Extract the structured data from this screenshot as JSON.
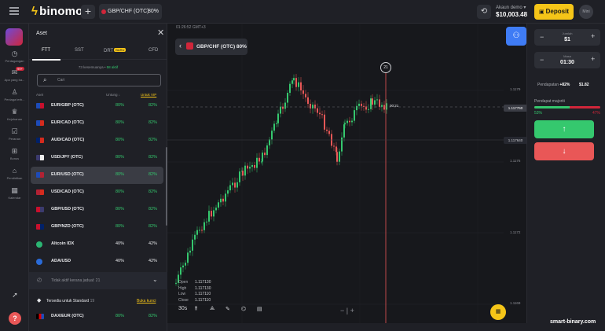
{
  "header": {
    "brand": "binomo",
    "asset_tab": {
      "label": "GBP/CHF (OTC)",
      "percent": "80%"
    },
    "account": {
      "label": "Akaun demo ▾",
      "balance": "$10,003.48"
    },
    "deposit_label": "Deposit",
    "avatar_text": "Mini"
  },
  "nav": [
    {
      "icon": "chart-icon",
      "label": "Perdagangan"
    },
    {
      "icon": "gift-icon",
      "label": "Apa yang ba...",
      "badge": "99+"
    },
    {
      "icon": "trader-icon",
      "label": "Peniaga terb..."
    },
    {
      "icon": "trophy-icon",
      "label": "Kejohanan"
    },
    {
      "icon": "tasks-icon",
      "label": "Peranan"
    },
    {
      "icon": "bonus-icon",
      "label": "Bonus"
    },
    {
      "icon": "education-icon",
      "label": "Pendidikan"
    },
    {
      "icon": "calendar-icon",
      "label": "Kalendar"
    }
  ],
  "panel": {
    "title": "Aset",
    "tabs": [
      {
        "label": "FTT",
        "active": true
      },
      {
        "label": "SST",
        "active": false
      },
      {
        "label": "DRT",
        "badge": "BARU",
        "active": false
      },
      {
        "label": "CFD",
        "active": false
      }
    ],
    "counts": {
      "favorites": "73 kesemuanya",
      "active": "58 aktif"
    },
    "search_placeholder": "Cari",
    "columns": {
      "asset": "Aset",
      "profit": "Untung ↓",
      "profit_link": "Untuk VIP"
    },
    "rows": [
      {
        "name": "EUR/GBP (OTC)",
        "p1": "80%",
        "p2": "82%",
        "flag": "eu-gb"
      },
      {
        "name": "EUR/CAD (OTC)",
        "p1": "80%",
        "p2": "82%",
        "flag": "eu-ca"
      },
      {
        "name": "AUD/CAD (OTC)",
        "p1": "80%",
        "p2": "82%",
        "flag": "au-ca"
      },
      {
        "name": "USD/JPY (OTC)",
        "p1": "80%",
        "p2": "82%",
        "flag": "us-jp"
      },
      {
        "name": "EUR/USD (OTC)",
        "p1": "80%",
        "p2": "82%",
        "flag": "eu-us",
        "selected": true
      },
      {
        "name": "USD/CAD (OTC)",
        "p1": "80%",
        "p2": "82%",
        "flag": "us-ca"
      },
      {
        "name": "GBP/USD (OTC)",
        "p1": "80%",
        "p2": "82%",
        "flag": "gb-us"
      },
      {
        "name": "GBP/NZD (OTC)",
        "p1": "80%",
        "p2": "82%",
        "flag": "gb-nz"
      },
      {
        "name": "Altcoin IDX",
        "p1": "40%",
        "p2": "42%",
        "flag": "altcoin",
        "white": true
      },
      {
        "name": "ADA/USD",
        "p1": "40%",
        "p2": "42%",
        "flag": "ada",
        "white": true
      }
    ],
    "inactive_text": "Tidak aktif kerana jadual: 21",
    "standard": {
      "text": "Tersedia untuk Standard",
      "count": "19",
      "link": "Buka kunci"
    },
    "last_row": {
      "name": "DAX/EUR (OTC)",
      "p1": "80%",
      "p2": "82%"
    }
  },
  "chart": {
    "timestamp": "01:26:52 GMT+3",
    "asset_label": "GBP/CHF (OTC) 80%",
    "timer": "21",
    "expiry_time": "00:21",
    "price_ticks": [
      "1.1179",
      "1.117760",
      "1.117640",
      "1.1176",
      "1.1172",
      "1.1169"
    ],
    "ohlc": [
      {
        "k": "Open",
        "v": "1.117130"
      },
      {
        "k": "High",
        "v": "1.117130"
      },
      {
        "k": "Low",
        "v": "1.117110"
      },
      {
        "k": "Close",
        "v": "1.117110"
      }
    ],
    "timeframe": "30s",
    "colors": {
      "up": "#35c86e",
      "down": "#e95757"
    }
  },
  "trade": {
    "amount": {
      "caption": "Jumlah",
      "value": "$1"
    },
    "time": {
      "caption": "Masa",
      "value": "01:30"
    },
    "income": {
      "label": "Pendapatan",
      "percent": "+82%",
      "amount": "$1.82"
    },
    "traders_label": "Pendapat majoriti",
    "sentiment": {
      "up": "53%",
      "down": "47%",
      "up_fraction": 0.53
    }
  },
  "watermark": "smart-binary.com"
}
